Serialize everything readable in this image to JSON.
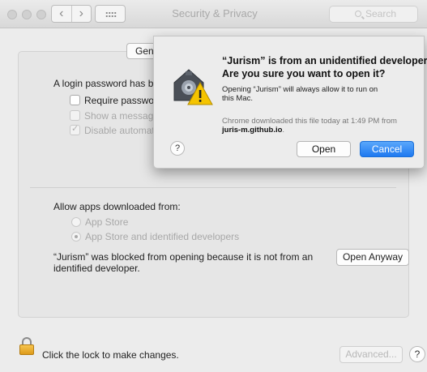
{
  "window": {
    "title": "Security & Privacy",
    "search_placeholder": "Search"
  },
  "general": {
    "tab_label": "Gen",
    "login_password_text": "A login password has be",
    "require_password_label": "Require password",
    "show_message_label": "Show a message",
    "disable_auto_label": "Disable automatic",
    "disable_auto_checked": true
  },
  "allow_apps": {
    "heading": "Allow apps downloaded from:",
    "options": [
      {
        "label": "App Store",
        "selected": false
      },
      {
        "label": "App Store and identified developers",
        "selected": true
      }
    ],
    "blocked_message_line1": "“Jurism” was blocked from opening because it is not from an",
    "blocked_message_line2": "identified developer.",
    "open_anyway_label": "Open Anyway"
  },
  "footer": {
    "lock_text": "Click the lock to make changes.",
    "advanced_label": "Advanced...",
    "help_label": "?"
  },
  "dialog": {
    "title_line1": "“Jurism” is from an unidentified developer.",
    "title_line2": "Are you sure you want to open it?",
    "message_line1": "Opening “Jurism” will always allow it to run on",
    "message_line2": "this Mac.",
    "download_line1": "Chrome downloaded this file today at 1:49 PM from",
    "download_source": "juris-m.github.io",
    "download_period": ".",
    "open_label": "Open",
    "cancel_label": "Cancel",
    "help_label": "?"
  },
  "colors": {
    "accent": "#1e79f0",
    "warning": "#f5c400"
  }
}
